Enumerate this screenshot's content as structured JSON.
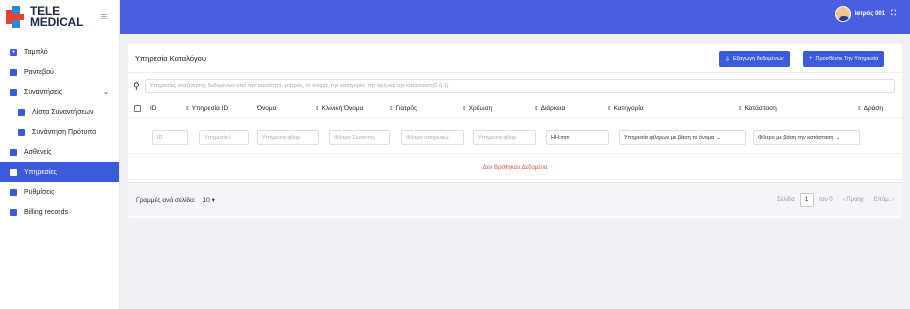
{
  "brand": {
    "line1": "TELE",
    "line2": "MEDICAL"
  },
  "sidebar": {
    "items": [
      {
        "label": "Ταμπλό",
        "icon": "dashboard-icon"
      },
      {
        "label": "Ραντεβού",
        "icon": "calendar-icon"
      },
      {
        "label": "Συναντήσεις",
        "icon": "meetings-icon"
      },
      {
        "label": "Λίστα Συναντήσεων",
        "icon": "list-icon"
      },
      {
        "label": "Συνάντηση Πρότυπα",
        "icon": "template-icon"
      },
      {
        "label": "Ασθενείς",
        "icon": "patients-icon"
      },
      {
        "label": "Υπηρεσίες",
        "icon": "services-icon"
      },
      {
        "label": "Ρυθμίσεις",
        "icon": "settings-icon"
      },
      {
        "label": "Billing records",
        "icon": "billing-icon"
      }
    ]
  },
  "topbar": {
    "user_name": "Ιατρός 001"
  },
  "card": {
    "title": "Υπηρεσία Καταλόγου",
    "export_label": "Εξαγωγή δεδομένων",
    "add_label": "Προσθέστε Την Υπηρεσία"
  },
  "search": {
    "placeholder": "Υπηρεσίες αναζήτησης δεδομένων από την ταυτότητα, γιατρός, το όνομα, την κατηγορία, την τιμή και την κατάσταση(0 ή 1)"
  },
  "table": {
    "columns": [
      "ID",
      "Υπηρεσία ID",
      "Όνομα",
      "Κλινική Όνομα",
      "Γιατρός",
      "Χρέωση",
      "Διάρκεια",
      "Κατηγορία",
      "Κατάσταση",
      "Δράση"
    ],
    "filters": [
      "ID",
      "Υπηρεσία ί",
      "Υπηρεσία φίλτρ",
      "Φίλτρο Συνάντης",
      "Φίλτρο υπηρεσιώ",
      "Υπηρεσία φίλτρ",
      "HH:mm",
      "Υπηρεσία φίλτρων με βάση το όνομα",
      "Φίλτρο με βάση την κατάσταση"
    ],
    "empty": "Δεν Βρέθηκαν Δεδομένα"
  },
  "footer": {
    "rows_label": "Γραμμές ανά σελίδα:",
    "rows_value": "10",
    "page_label": "Σελίδα",
    "page_num": "1",
    "of_label": "του 0",
    "prev": "Προηγ",
    "next": "Επόμ."
  }
}
